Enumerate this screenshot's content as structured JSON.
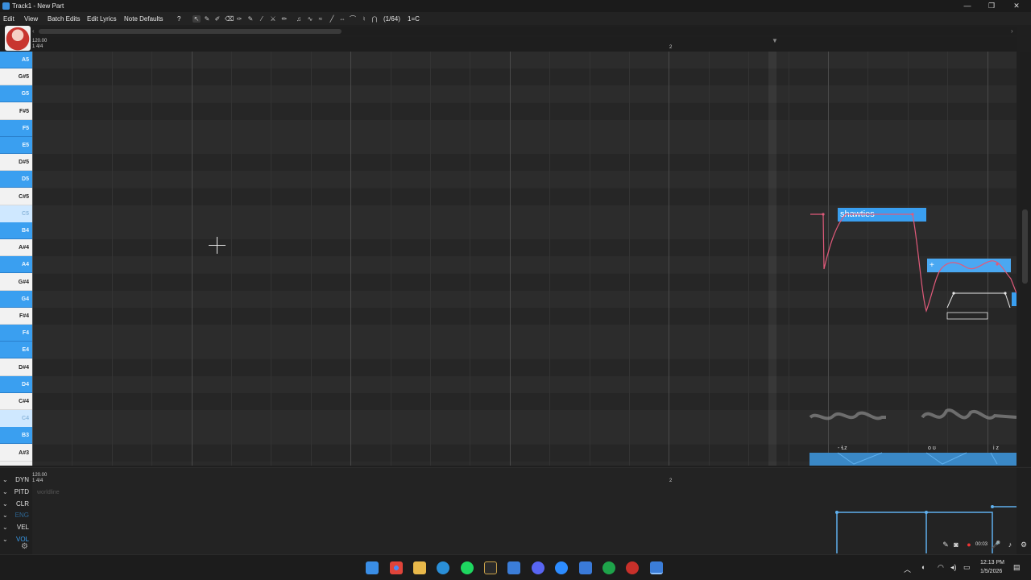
{
  "window": {
    "title": "Track1 - New Part",
    "controls": [
      "—",
      "❐",
      "✕"
    ]
  },
  "menu": {
    "items": [
      "Edit",
      "View",
      "Batch Edits",
      "Edit Lyrics",
      "Note Defaults",
      "?"
    ],
    "snap_label": "(1/64)",
    "key_label": "1=C"
  },
  "ruler": {
    "tempo": "120.00",
    "signature": "1 4/4",
    "bar2": "2"
  },
  "piano_keys": [
    {
      "label": "A5",
      "type": "white"
    },
    {
      "label": "G#5",
      "type": "black"
    },
    {
      "label": "G5",
      "type": "white"
    },
    {
      "label": "F#5",
      "type": "black"
    },
    {
      "label": "F5",
      "type": "white"
    },
    {
      "label": "E5",
      "type": "white"
    },
    {
      "label": "D#5",
      "type": "black"
    },
    {
      "label": "D5",
      "type": "white"
    },
    {
      "label": "C#5",
      "type": "black"
    },
    {
      "label": "C5",
      "type": "highlight"
    },
    {
      "label": "B4",
      "type": "white"
    },
    {
      "label": "A#4",
      "type": "black"
    },
    {
      "label": "A4",
      "type": "white"
    },
    {
      "label": "G#4",
      "type": "black"
    },
    {
      "label": "G4",
      "type": "white"
    },
    {
      "label": "F#4",
      "type": "black"
    },
    {
      "label": "F4",
      "type": "white"
    },
    {
      "label": "E4",
      "type": "white"
    },
    {
      "label": "D#4",
      "type": "black"
    },
    {
      "label": "D4",
      "type": "white"
    },
    {
      "label": "C#4",
      "type": "black"
    },
    {
      "label": "C4",
      "type": "highlight"
    },
    {
      "label": "B3",
      "type": "white"
    },
    {
      "label": "A#3",
      "type": "black"
    }
  ],
  "notes": [
    {
      "lyric": "shawties",
      "pitch": "C5"
    },
    {
      "lyric": "+",
      "pitch": "A4"
    }
  ],
  "phonemes": [
    "- Ɫz",
    "o ʊ",
    "i z"
  ],
  "expressions": {
    "tempo": "120.00",
    "signature": "1 4/4",
    "bar2": "2",
    "ghost_label": "worldline",
    "items": [
      {
        "label": "DYN",
        "state": "normal"
      },
      {
        "label": "PITD",
        "state": "normal"
      },
      {
        "label": "CLR",
        "state": "normal"
      },
      {
        "label": "ENG",
        "state": "dim"
      },
      {
        "label": "VEL",
        "state": "normal"
      },
      {
        "label": "VOL",
        "state": "highlight"
      }
    ]
  },
  "taskbar": {
    "clock_time": "12:13 PM",
    "clock_date": "1/5/2026",
    "rec_time": "00:03",
    "colors": {
      "accent": "#3a9ff0",
      "pitch_curve": "#e05a7a",
      "note": "#3a9ff0"
    }
  }
}
